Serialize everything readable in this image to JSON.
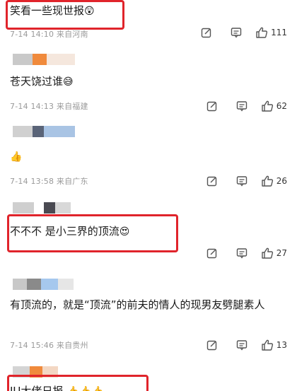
{
  "comments": [
    {
      "text": "笑看一些现世报",
      "emoji": "😲",
      "date": "7-14",
      "time": "14:10",
      "location": "来自河南",
      "likes": "111",
      "highlight": true
    },
    {
      "text": "苍天饶过谁",
      "emoji": "😅",
      "date": "7-14",
      "time": "14:13",
      "location": "来自福建",
      "likes": "62",
      "highlight": false
    },
    {
      "text": "",
      "emoji": "👍",
      "date": "7-14",
      "time": "13:58",
      "location": "来自广东",
      "likes": "26",
      "highlight": false
    },
    {
      "text": "不不不  是小三界的顶流",
      "emoji": "😍",
      "date": "",
      "time": "",
      "location": "",
      "likes": "27",
      "highlight": true
    },
    {
      "text": "有顶流的，就是“顶流”的前夫的情人的现男友劈腿素人",
      "emoji": "",
      "date": "7-14",
      "time": "15:46",
      "location": "来自贵州",
      "likes": "13",
      "highlight": false
    },
    {
      "text": "IU大佬日报",
      "emoji": "👍👍👍",
      "date": "",
      "time": "",
      "location": "",
      "likes": "",
      "highlight": true
    }
  ],
  "icons": [
    "share-icon",
    "comment-icon",
    "like-icon"
  ],
  "colors": {
    "highlight": "#e0242b",
    "meta": "#9a9a9a"
  }
}
